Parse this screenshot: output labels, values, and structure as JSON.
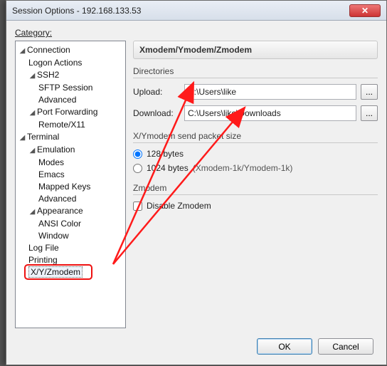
{
  "window": {
    "title": "Session Options - 192.168.133.53"
  },
  "category_label": "Category:",
  "tree": {
    "connection": "Connection",
    "logon_actions": "Logon Actions",
    "ssh2": "SSH2",
    "sftp_session": "SFTP Session",
    "advanced1": "Advanced",
    "port_forwarding": "Port Forwarding",
    "remote_x11": "Remote/X11",
    "terminal": "Terminal",
    "emulation": "Emulation",
    "modes": "Modes",
    "emacs": "Emacs",
    "mapped_keys": "Mapped Keys",
    "advanced2": "Advanced",
    "appearance": "Appearance",
    "ansi_color": "ANSI Color",
    "window": "Window",
    "log_file": "Log File",
    "printing": "Printing",
    "xyzmodem": "X/Y/Zmodem"
  },
  "pane": {
    "heading": "Xmodem/Ymodem/Zmodem",
    "directories": {
      "title": "Directories",
      "upload_label": "Upload:",
      "upload_value": "C:\\Users\\like",
      "download_label": "Download:",
      "download_value": "C:\\Users\\like\\Downloads",
      "browse": "..."
    },
    "packet": {
      "title": "X/Ymodem send packet size",
      "opt128": "128 bytes",
      "opt1024": "1024 bytes",
      "opt1024_suffix": "(Xmodem-1k/Ymodem-1k)"
    },
    "zmodem": {
      "title": "Zmodem",
      "disable": "Disable Zmodem"
    }
  },
  "buttons": {
    "ok": "OK",
    "cancel": "Cancel"
  },
  "twist": {
    "open": "◢",
    "closed": "▷"
  }
}
